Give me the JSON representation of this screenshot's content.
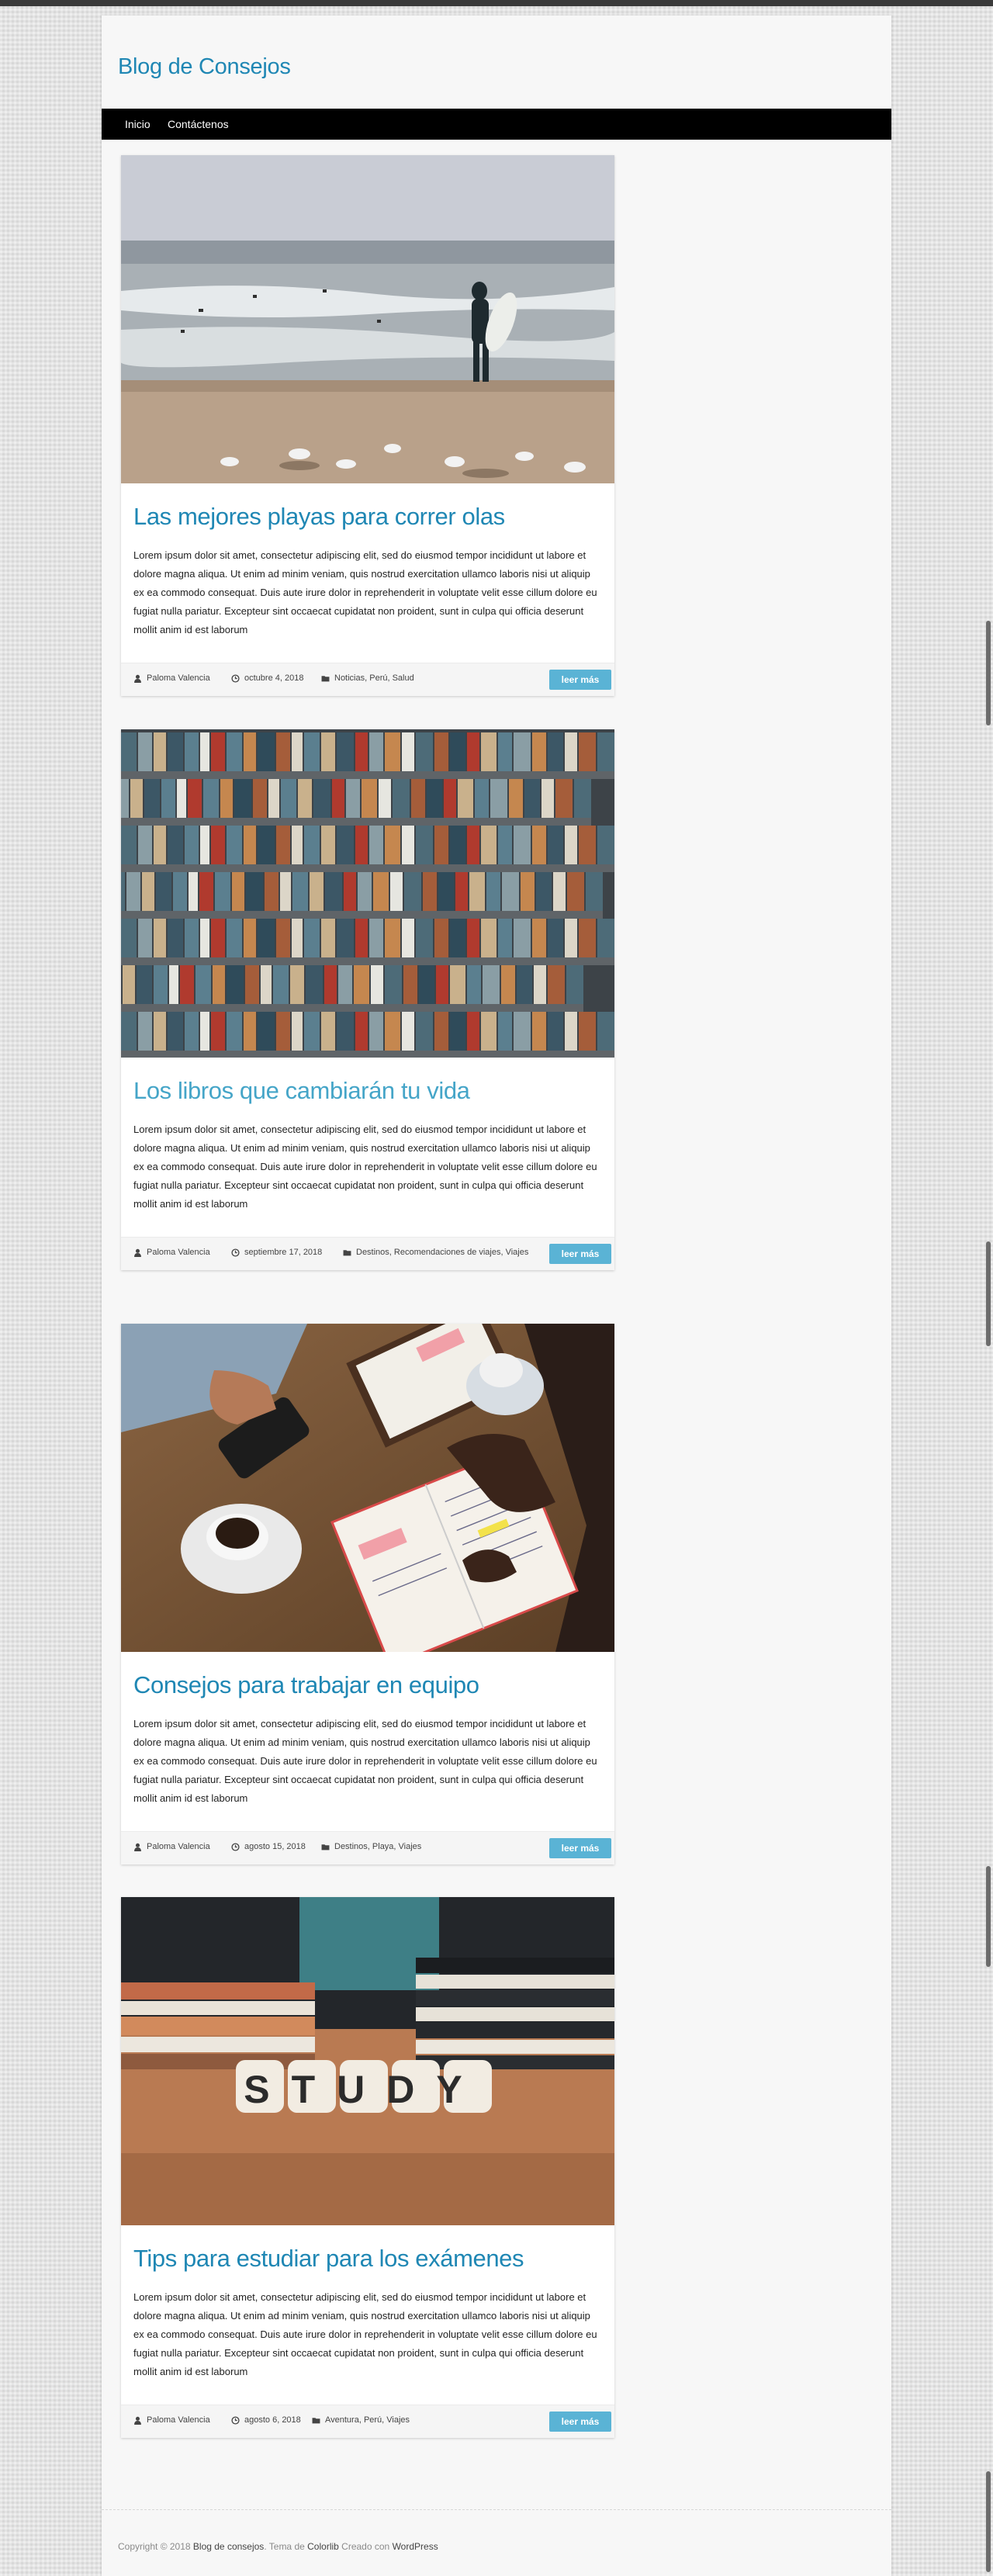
{
  "site": {
    "title": "Blog de Consejos"
  },
  "nav": [
    {
      "label": "Inicio"
    },
    {
      "label": "Contáctenos"
    }
  ],
  "posts": [
    {
      "title": "Las mejores playas para correr olas",
      "image_alt": "surfer",
      "excerpt": "Lorem ipsum dolor sit amet, consectetur adipiscing elit, sed do eiusmod tempor incididunt ut labore et dolore magna aliqua. Ut enim ad minim veniam, quis nostrud exercitation ullamco laboris nisi ut aliquip ex ea commodo consequat. Duis aute irure dolor in reprehenderit in voluptate velit esse cillum dolore eu fugiat nulla pariatur. Excepteur sint occaecat cupidatat non proident, sunt in culpa qui officia deserunt mollit anim id est laborum",
      "author": "Paloma Valencia",
      "date": "octubre 4, 2018",
      "categories": "Noticias, Perú, Salud",
      "read_more": "leer más"
    },
    {
      "title": "Los libros que cambiarán tu vida",
      "image_alt": "bookshelf",
      "excerpt": "Lorem ipsum dolor sit amet, consectetur adipiscing elit, sed do eiusmod tempor incididunt ut labore et dolore magna aliqua. Ut enim ad minim veniam, quis nostrud exercitation ullamco laboris nisi ut aliquip ex ea commodo consequat. Duis aute irure dolor in reprehenderit in voluptate velit esse cillum dolore eu fugiat nulla pariatur. Excepteur sint occaecat cupidatat non proident, sunt in culpa qui officia deserunt mollit anim id est laborum",
      "author": "Paloma Valencia",
      "date": "septiembre 17, 2018",
      "categories": "Destinos, Recomendaciones de viajes, Viajes",
      "read_more": "leer más"
    },
    {
      "title": "Consejos para trabajar en equipo",
      "image_alt": "team meeting",
      "excerpt": "Lorem ipsum dolor sit amet, consectetur adipiscing elit, sed do eiusmod tempor incididunt ut labore et dolore magna aliqua. Ut enim ad minim veniam, quis nostrud exercitation ullamco laboris nisi ut aliquip ex ea commodo consequat. Duis aute irure dolor in reprehenderit in voluptate velit esse cillum dolore eu fugiat nulla pariatur. Excepteur sint occaecat cupidatat non proident, sunt in culpa qui officia deserunt mollit anim id est laborum",
      "author": "Paloma Valencia",
      "date": "agosto 15, 2018",
      "categories": "Destinos, Playa, Viajes",
      "read_more": "leer más"
    },
    {
      "title": "Tips para estudiar para los exámenes",
      "image_alt": "study",
      "image_text": "STUDY",
      "excerpt": "Lorem ipsum dolor sit amet, consectetur adipiscing elit, sed do eiusmod tempor incididunt ut labore et dolore magna aliqua. Ut enim ad minim veniam, quis nostrud exercitation ullamco laboris nisi ut aliquip ex ea commodo consequat. Duis aute irure dolor in reprehenderit in voluptate velit esse cillum dolore eu fugiat nulla pariatur. Excepteur sint occaecat cupidatat non proident, sunt in culpa qui officia deserunt mollit anim id est laborum",
      "author": "Paloma Valencia",
      "date": "agosto 6, 2018",
      "categories": "Aventura, Perú, Viajes",
      "read_more": "leer más"
    }
  ],
  "footer": {
    "copyright": "Copyright © 2018",
    "site_link": "Blog de consejos",
    "theme_prefix": ". Tema de",
    "theme_link": "Colorlib",
    "powered_prefix": "Creado con",
    "powered_link": "WordPress"
  },
  "colors": {
    "accent": "#1f87b4",
    "button": "#5ab3d5",
    "navbar": "#000000"
  }
}
